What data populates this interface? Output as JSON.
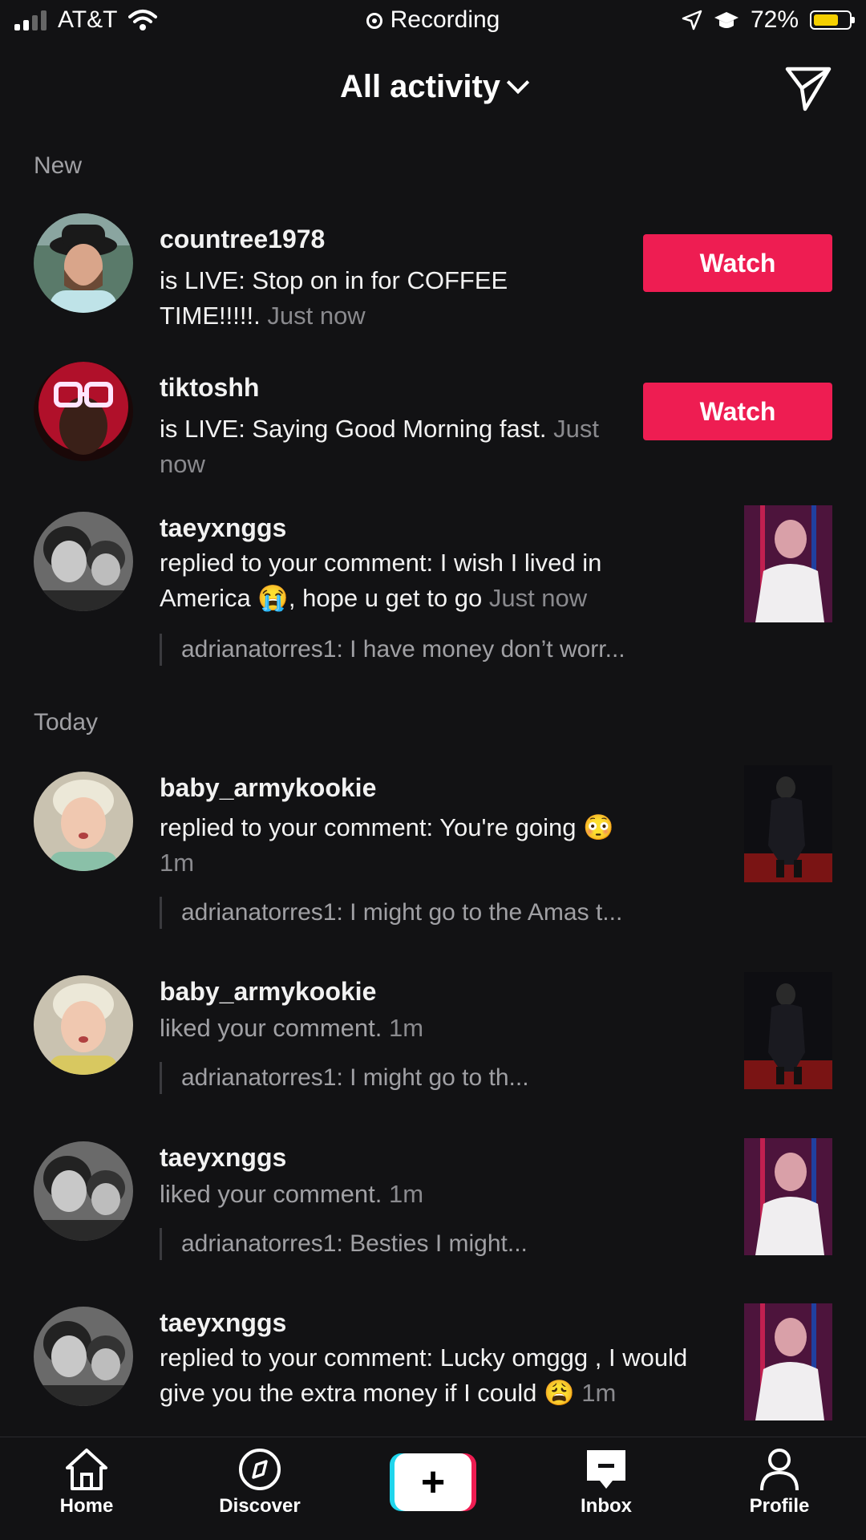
{
  "status_bar": {
    "carrier": "AT&T",
    "recording_label": "Recording",
    "battery_text": "72%",
    "battery_level": 0.72
  },
  "header": {
    "title": "All activity"
  },
  "sections": {
    "new": "New",
    "today": "Today"
  },
  "items": [
    {
      "username": "countree1978",
      "text": "is LIVE: Stop on in for COFFEE TIME!!!!!.",
      "time": "Just now",
      "action": "Watch"
    },
    {
      "username": "tiktoshh",
      "text": "is LIVE: Saying Good Morning fast.",
      "time": "Just now",
      "action": "Watch"
    },
    {
      "username": "taeyxnggs",
      "text": "replied to your comment: I wish I lived in America 😭, hope u get to go",
      "time": "Just now",
      "reply": "adrianatorres1: I have money don’t worr..."
    },
    {
      "username": "baby_armykookie",
      "text": "replied to your comment: You're going 😳",
      "time": "1m",
      "reply": "adrianatorres1: I might go to the Amas t..."
    },
    {
      "username": "baby_armykookie",
      "text": "liked your comment.",
      "time": "1m",
      "reply": "adrianatorres1: I might go to th..."
    },
    {
      "username": "taeyxnggs",
      "text": "liked your comment.",
      "time": "1m",
      "reply": "adrianatorres1: Besties I might..."
    },
    {
      "username": "taeyxnggs",
      "text": "replied to your comment: Lucky omggg , I would give you the extra money if I could 😩",
      "time": "1m"
    }
  ],
  "nav": {
    "home": "Home",
    "discover": "Discover",
    "create": "+",
    "inbox": "Inbox",
    "profile": "Profile"
  },
  "colors": {
    "background": "#121214",
    "watch_button": "#ee1d52",
    "battery": "#f5d000"
  }
}
